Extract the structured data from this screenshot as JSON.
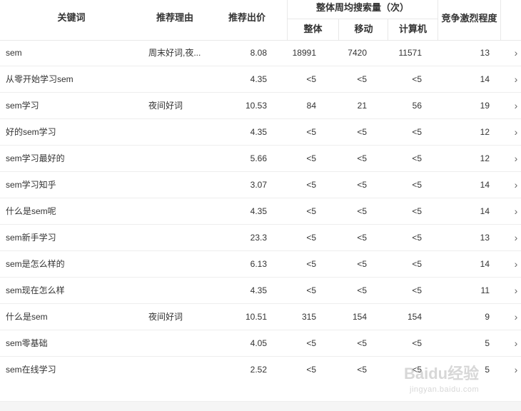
{
  "header": {
    "keyword": "关键词",
    "reason": "推荐理由",
    "bid": "推荐出价",
    "search_volume_group": "整体周均搜索量（次）",
    "overall": "整体",
    "mobile": "移动",
    "pc": "计算机",
    "competition": "竞争激烈程度"
  },
  "rows": [
    {
      "keyword": "sem",
      "reason": "周末好词,夜...",
      "bid": "8.08",
      "overall": "18991",
      "mobile": "7420",
      "pc": "11571",
      "competition": "13"
    },
    {
      "keyword": "从零开始学习sem",
      "reason": "",
      "bid": "4.35",
      "overall": "<5",
      "mobile": "<5",
      "pc": "<5",
      "competition": "14"
    },
    {
      "keyword": "sem学习",
      "reason": "夜间好词",
      "bid": "10.53",
      "overall": "84",
      "mobile": "21",
      "pc": "56",
      "competition": "19"
    },
    {
      "keyword": "好的sem学习",
      "reason": "",
      "bid": "4.35",
      "overall": "<5",
      "mobile": "<5",
      "pc": "<5",
      "competition": "12"
    },
    {
      "keyword": "sem学习最好的",
      "reason": "",
      "bid": "5.66",
      "overall": "<5",
      "mobile": "<5",
      "pc": "<5",
      "competition": "12"
    },
    {
      "keyword": "sem学习知乎",
      "reason": "",
      "bid": "3.07",
      "overall": "<5",
      "mobile": "<5",
      "pc": "<5",
      "competition": "14"
    },
    {
      "keyword": "什么是sem呢",
      "reason": "",
      "bid": "4.35",
      "overall": "<5",
      "mobile": "<5",
      "pc": "<5",
      "competition": "14"
    },
    {
      "keyword": "sem新手学习",
      "reason": "",
      "bid": "23.3",
      "overall": "<5",
      "mobile": "<5",
      "pc": "<5",
      "competition": "13"
    },
    {
      "keyword": "sem是怎么样的",
      "reason": "",
      "bid": "6.13",
      "overall": "<5",
      "mobile": "<5",
      "pc": "<5",
      "competition": "14"
    },
    {
      "keyword": "sem现在怎么样",
      "reason": "",
      "bid": "4.35",
      "overall": "<5",
      "mobile": "<5",
      "pc": "<5",
      "competition": "11"
    },
    {
      "keyword": "什么是sem",
      "reason": "夜间好词",
      "bid": "10.51",
      "overall": "315",
      "mobile": "154",
      "pc": "154",
      "competition": "9"
    },
    {
      "keyword": "sem零基础",
      "reason": "",
      "bid": "4.05",
      "overall": "<5",
      "mobile": "<5",
      "pc": "<5",
      "competition": "5"
    },
    {
      "keyword": "sem在线学习",
      "reason": "",
      "bid": "2.52",
      "overall": "<5",
      "mobile": "<5",
      "pc": "<5",
      "competition": "5"
    }
  ],
  "row_arrow": "›",
  "watermark": {
    "text": "Baidu经验",
    "url": "jingyan.baidu.com"
  }
}
